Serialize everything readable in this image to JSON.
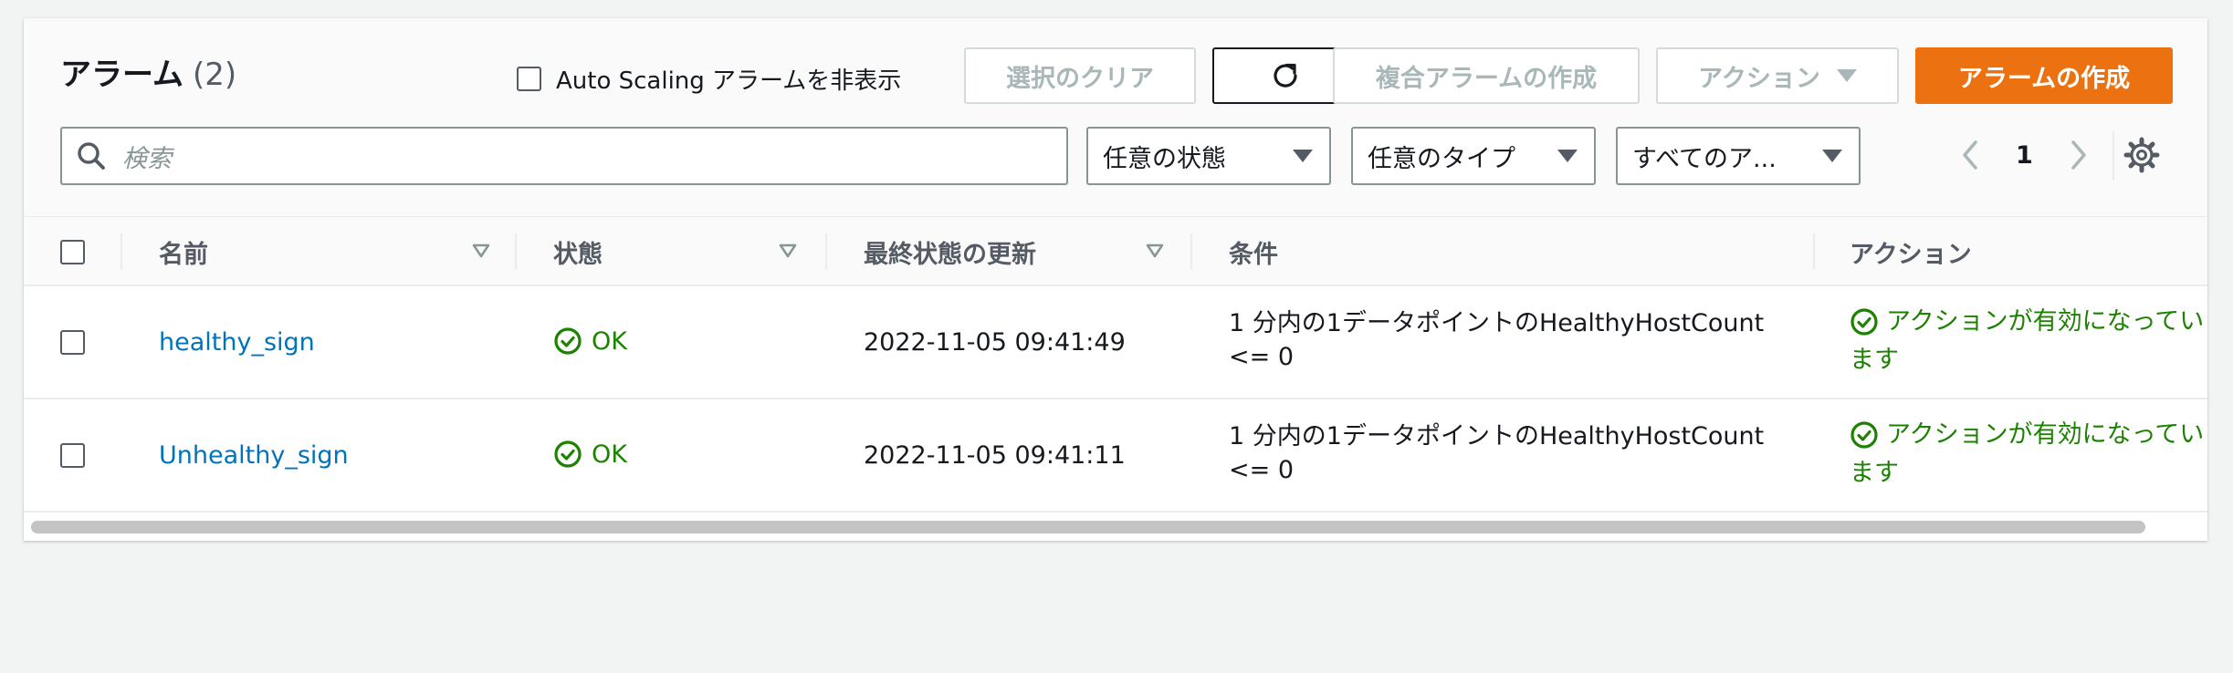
{
  "header": {
    "title": "アラーム",
    "count": "(2)",
    "hide_autoscaling_label": "Auto Scaling アラームを非表示",
    "clear_selection_label": "選択のクリア",
    "create_composite_label": "複合アラームの作成",
    "actions_label": "アクション",
    "create_alarm_label": "アラームの作成"
  },
  "filters": {
    "search_placeholder": "検索",
    "state_select": "任意の状態",
    "type_select": "任意のタイプ",
    "actions_select": "すべてのア..."
  },
  "pagination": {
    "current_page": "1"
  },
  "table": {
    "columns": [
      "名前",
      "状態",
      "最終状態の更新",
      "条件",
      "アクション"
    ],
    "rows": [
      {
        "name": "healthy_sign",
        "state": "OK",
        "last_update": "2022-11-05 09:41:49",
        "condition_line1": "1 分内の1データポイントのHealthyHostCount",
        "condition_line2": "<= 0",
        "actions_line1": "アクションが有効になってい",
        "actions_line2": "ます"
      },
      {
        "name": "Unhealthy_sign",
        "state": "OK",
        "last_update": "2022-11-05 09:41:11",
        "condition_line1": "1 分内の1データポイントのHealthyHostCount",
        "condition_line2": "<= 0",
        "actions_line1": "アクションが有効になってい",
        "actions_line2": "ます"
      }
    ]
  },
  "colors": {
    "primary": "#ec7211",
    "link": "#0073bb",
    "success": "#1d8102",
    "disabled_text": "#aab7b8"
  }
}
